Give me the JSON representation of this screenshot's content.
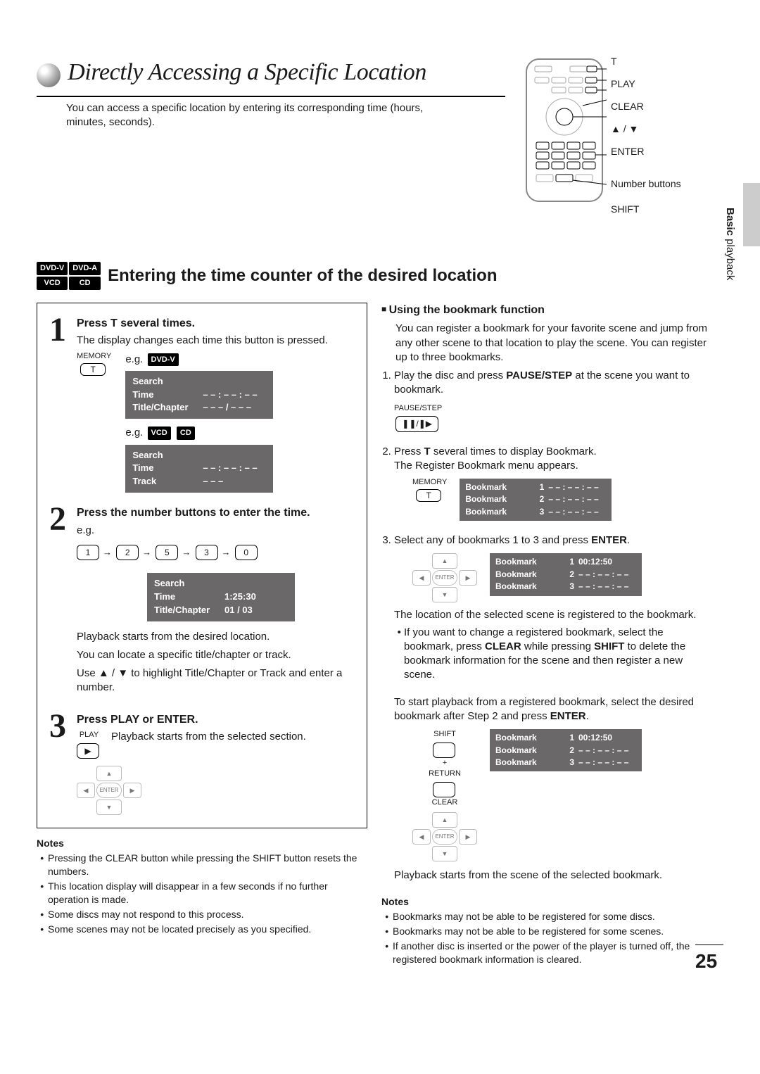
{
  "page": {
    "title": "Directly Accessing a Specific Location",
    "intro": "You can access a specific location by entering its corresponding time (hours, minutes, seconds).",
    "number": "25",
    "section_tab": {
      "bold": "Basic",
      "rest": " playback"
    }
  },
  "remote": {
    "labels": [
      "T",
      "PLAY",
      "CLEAR",
      "▲ / ▼",
      "ENTER",
      "Number buttons",
      "SHIFT"
    ]
  },
  "section": {
    "badges": [
      "DVD-V",
      "DVD-A",
      "VCD",
      "CD"
    ],
    "heading": "Entering the time counter of the desired location"
  },
  "steps": {
    "s1": {
      "title": "Press T several times.",
      "text": "The display changes each time this button is pressed.",
      "memory_label": "MEMORY",
      "memory_btn": "T",
      "eg": "e.g.",
      "dvdv": "DVD-V",
      "vcd": "VCD",
      "cd": "CD",
      "osd1": {
        "r1": "Search",
        "r2a": "Time",
        "r2b": "– – : – – : – –",
        "r3a": "Title/Chapter",
        "r3b": "– – – / – – –"
      },
      "osd2": {
        "r1": "Search",
        "r2a": "Time",
        "r2b": "– – : – – : – –",
        "r3a": "Track",
        "r3b": "– – –"
      }
    },
    "s2": {
      "title": "Press the number buttons to enter the time.",
      "eg": "e.g.",
      "keys": [
        "1",
        "2",
        "5",
        "3",
        "0"
      ],
      "osd": {
        "r1": "Search",
        "r2a": "Time",
        "r2b": "1:25:30",
        "r3a": "Title/Chapter",
        "r3b": "01 / 03"
      },
      "p1": "Playback starts from the desired location.",
      "p2": "You can locate a specific title/chapter or track.",
      "p3": "Use ▲ / ▼ to highlight Title/Chapter or Track and enter a number."
    },
    "s3": {
      "title": "Press PLAY or ENTER.",
      "play_label": "PLAY",
      "text": "Playback starts from the selected section.",
      "enter": "ENTER"
    }
  },
  "notes_left": {
    "heading": "Notes",
    "items": [
      "Pressing the CLEAR button while pressing the SHIFT button resets the numbers.",
      "This location display will disappear in a few seconds if no further operation is made.",
      "Some discs may not respond to this process.",
      "Some scenes may not be located precisely as you specified."
    ]
  },
  "bookmark": {
    "heading": "Using the bookmark function",
    "intro": "You can register a bookmark for your favorite scene and jump from any other scene to that location to play the scene. You can register up to three bookmarks.",
    "li1_a": "Play the disc and press ",
    "li1_b": "PAUSE/STEP",
    "li1_c": " at the scene you want to bookmark.",
    "pause_label": "PAUSE/STEP",
    "li2_a": "Press ",
    "li2_b": "T",
    "li2_c": " several times to display Bookmark.",
    "li2_d": "The Register Bookmark menu appears.",
    "memory_label": "MEMORY",
    "memory_btn": "T",
    "osd_empty": [
      [
        "Bookmark",
        "1",
        "– – : – – : – –"
      ],
      [
        "Bookmark",
        "2",
        "– – : – – : – –"
      ],
      [
        "Bookmark",
        "3",
        "– – : – – : – –"
      ]
    ],
    "li3_a": "Select any of bookmarks 1 to 3 and press ",
    "li3_b": "ENTER",
    "li3_c": ".",
    "enter": "ENTER",
    "osd_sel": [
      [
        "Bookmark",
        "1",
        "00:12:50"
      ],
      [
        "Bookmark",
        "2",
        "– – : – – : – –"
      ],
      [
        "Bookmark",
        "3",
        "– – : – – : – –"
      ]
    ],
    "reg_text": "The location of the selected scene is registered to the bookmark.",
    "change_a": "If you want to change a registered bookmark, select the bookmark, press ",
    "change_b": "CLEAR",
    "change_c": " while pressing ",
    "change_d": "SHIFT",
    "change_e": " to delete the bookmark information for the scene and then register a new scene.",
    "start_a": "To start playback from a registered bookmark, select the desired bookmark after Step 2 and press ",
    "start_b": "ENTER",
    "start_c": ".",
    "shift_label": "SHIFT",
    "return_label": "RETURN",
    "clear_label": "CLEAR",
    "plus": "+",
    "play_text": "Playback starts from the scene of the selected bookmark."
  },
  "notes_right": {
    "heading": "Notes",
    "items": [
      "Bookmarks may not be able to be registered for some discs.",
      "Bookmarks may not be able to be registered for some scenes.",
      "If another disc is inserted or the power of the player is turned off, the registered bookmark information is cleared."
    ]
  }
}
